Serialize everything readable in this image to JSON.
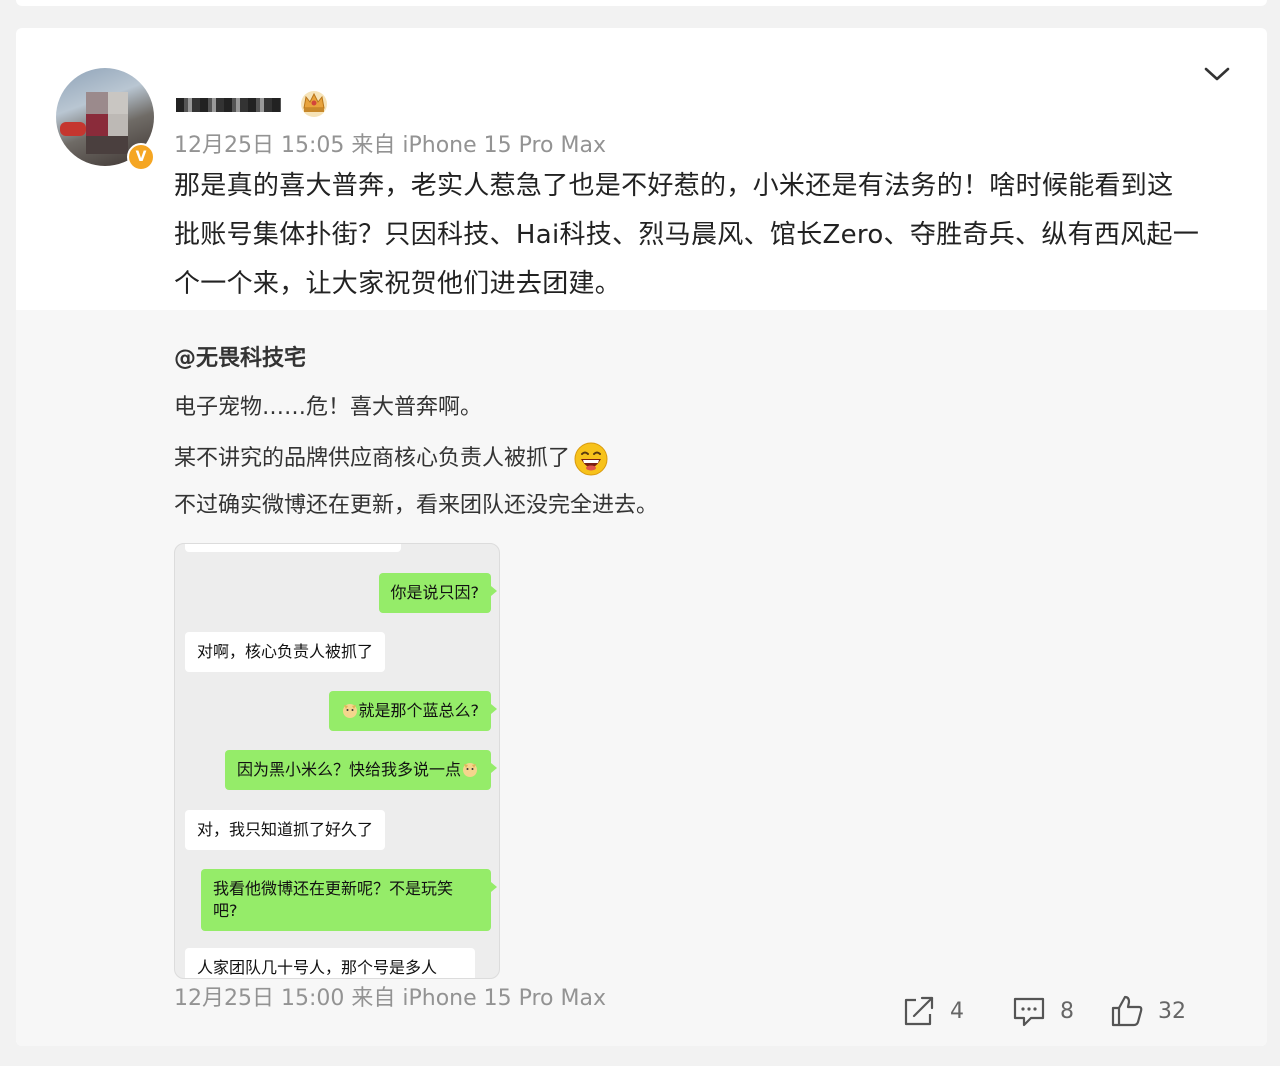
{
  "post": {
    "username": "",
    "time_source": "12月25日 15:05   来自 iPhone 15 Pro Max",
    "text_lines": [
      "那是真的喜大普奔，老实人惹急了也是不好惹的，小米还是有法务的！啥时候能看到这",
      "批账号集体扑街？只因科技、Hai科技、烈马晨风、馆长Zero、夺胜奇兵、纵有西风起一",
      "个一个来，让大家祝贺他们进去团建。"
    ]
  },
  "repost": {
    "author": "@无畏科技宅",
    "line1": "电子宠物……危！喜大普奔啊。",
    "line2": "某不讲究的品牌供应商核心负责人被抓了",
    "line3": "不过确实微博还在更新，看来团队还没完全进去。",
    "chat": {
      "msg1": "你是说只因?",
      "msg2": "对啊，核心负责人被抓了",
      "msg3": "就是那个蓝总么?",
      "msg4": "因为黑小米么？快给我多说一点",
      "msg5": "对，我只知道抓了好久了",
      "msg6a": "我看他微博还在更新呢？不是玩笑",
      "msg6b": "吧?",
      "msg7": "人家团队几十号人，那个号是多人"
    },
    "time_source": "12月25日 15:00 来自 iPhone 15 Pro Max",
    "reposts": "4",
    "comments": "8",
    "likes": "32"
  },
  "colors": {
    "background": "#f2f2f2",
    "card": "#ffffff",
    "repost_bg": "#f7f7f7",
    "meta_text": "#939393",
    "chat_me": "#95ec69",
    "verified": "#f5a623"
  },
  "icons": [
    "chevron-down-icon",
    "verified-icon",
    "crown-badge-icon",
    "laugh-emoji-icon",
    "dog-emoji-icon",
    "repost-icon",
    "comment-icon",
    "like-icon"
  ]
}
